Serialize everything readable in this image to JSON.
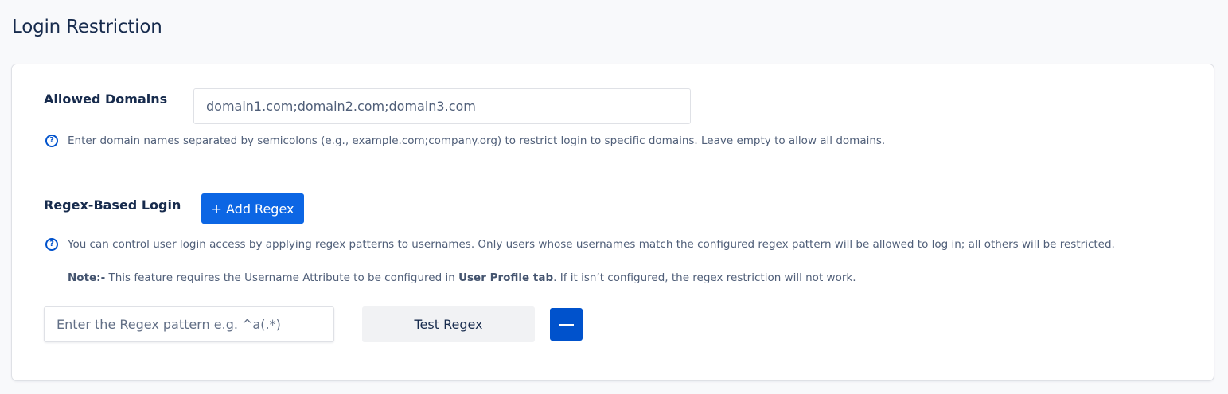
{
  "page": {
    "title": "Login Restriction"
  },
  "allowed_domains": {
    "label": "Allowed Domains",
    "value": "domain1.com;domain2.com;domain3.com",
    "help_icon": "question-circle-icon",
    "help_text": "Enter domain names separated by semicolons (e.g., example.com;company.org) to restrict login to specific domains. Leave empty to allow all domains."
  },
  "regex_login": {
    "label": "Regex-Based Login",
    "add_button_label": "+ Add Regex",
    "help_icon": "question-circle-icon",
    "help_text": "You can control user login access by applying regex patterns to usernames. Only users whose usernames match the configured regex pattern will be allowed to log in; all others will be restricted.",
    "note_label": "Note:-",
    "note_text_before": " This feature requires the Username Attribute to be configured in ",
    "note_link_text": "User Profile tab",
    "note_text_after": ". If it isn’t configured, the regex restriction will not work.",
    "pattern_placeholder": "Enter the Regex pattern e.g. ^a(.*)",
    "pattern_value": "",
    "test_button_label": "Test Regex",
    "remove_icon": "minus-icon"
  },
  "colors": {
    "primary": "#0c66e4",
    "primary_dark": "#0052cc",
    "text": "#172b4d",
    "muted_text": "#505f79",
    "border": "#dfe1e6",
    "page_background": "#f8f9fb",
    "secondary_button": "#f1f2f4"
  }
}
